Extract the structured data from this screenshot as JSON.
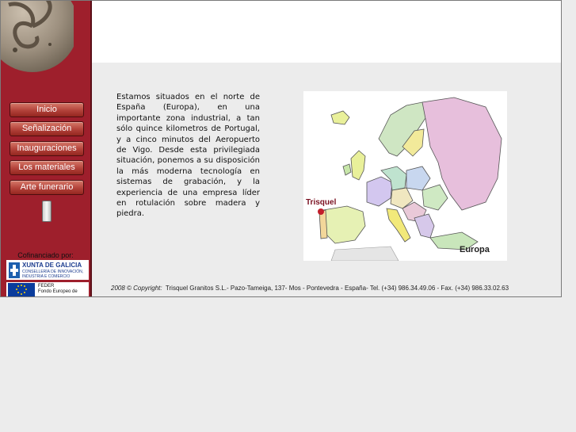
{
  "nav": {
    "items": [
      "Inicio",
      "Señalización",
      "Inauguraciones",
      "Los materiales",
      "Arte funerario"
    ]
  },
  "sidebar": {
    "cofinanced_label": "Cofinanciado por:",
    "xunta_title": "XUNTA DE GALICIA",
    "xunta_sub1": "CONSELLERÍA DE INNOVACIÓN,",
    "xunta_sub2": "INDUSTRIA E COMERCIO",
    "feder_title": "FEDER",
    "feder_sub": "Fondo Europeo de"
  },
  "main": {
    "intro": "Estamos situados en el norte de España (Europa), en una importante zona industrial, a tan sólo quince kilometros de Portugal, y a cinco minutos del Aeropuerto de Vigo. Desde esta privilegiada situación, ponemos a su disposición la más moderna tecnología en sistemas de grabación, y la experiencia de una empresa líder en rotulación sobre madera y piedra."
  },
  "map": {
    "location_label": "Trisquel",
    "region_label": "Europa",
    "marker_color": "#c21e2a",
    "label_color": "#7a1020"
  },
  "footer": {
    "copyright": "2008 © Copyright:",
    "details": "Trisquel Granitos S.L.- Pazo-Tameiga, 137-  Mos - Pontevedra - España- Tel. (+34) 986.34.49.06 - Fax. (+34) 986.33.02.63"
  },
  "colors": {
    "sidebar": "#9e1f2c",
    "button": "#b3423a",
    "page_background": "#ececec"
  }
}
